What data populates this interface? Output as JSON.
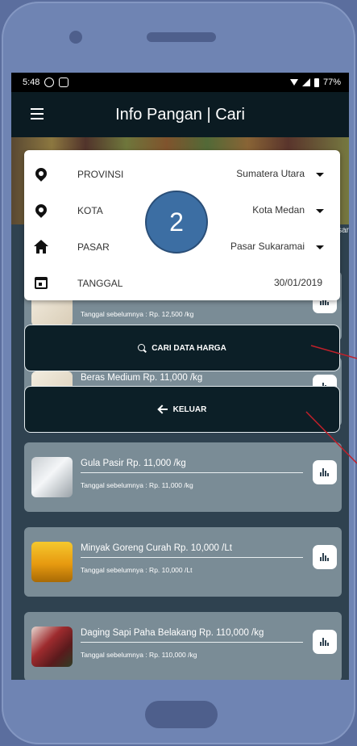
{
  "statusbar": {
    "time": "5:48",
    "battery": "77%"
  },
  "appbar": {
    "title": "Info Pangan | Cari"
  },
  "banner": {
    "edge_text": "sar"
  },
  "filters": {
    "provinsi": {
      "label": "PROVINSI",
      "value": "Sumatera Utara"
    },
    "kota": {
      "label": "KOTA",
      "value": "Kota Medan"
    },
    "pasar": {
      "label": "PASAR",
      "value": "Pasar Sukaramai"
    },
    "tanggal": {
      "label": "TANGGAL",
      "value": "30/01/2019"
    }
  },
  "callout_number": "2",
  "buttons": {
    "search": "CARI DATA HARGA",
    "exit": "KELUAR"
  },
  "items": [
    {
      "name": "",
      "prev": "Tanggal sebelumnya : Rp. 12,500 /kg"
    },
    {
      "name": "Beras Medium Rp. 11,000 /kg",
      "prev": ""
    },
    {
      "name": "Gula Pasir Rp. 11,000 /kg",
      "prev": "Tanggal sebelumnya : Rp. 11,000 /kg"
    },
    {
      "name": "Minyak Goreng Curah Rp. 10,000 /Lt",
      "prev": "Tanggal sebelumnya : Rp. 10,000 /Lt"
    },
    {
      "name": "Daging Sapi Paha Belakang Rp. 110,000 /kg",
      "prev": "Tanggal sebelumnya : Rp. 110,000 /kg"
    }
  ],
  "colors": {
    "appbar": "#0b1b22",
    "card": "#7a8c96",
    "badge": "#3c6ea3",
    "annotation_line": "#c0202a"
  }
}
